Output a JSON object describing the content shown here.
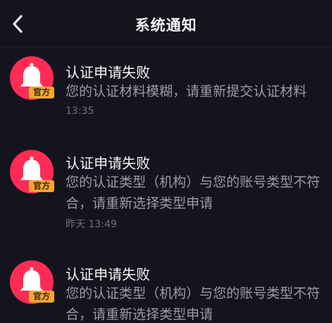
{
  "header": {
    "title": "系统通知",
    "back_icon": "chevron-left-icon"
  },
  "colors": {
    "background": "#14141f",
    "avatar_bg": "#fe2c55",
    "badge_bg": "#f4a536",
    "text_primary": "#f5f5f5",
    "text_secondary": "#9b9ba6",
    "text_time": "#6f6f7a"
  },
  "messages": [
    {
      "icon": "bell-icon",
      "badge": "官方",
      "title": "认证申请失败",
      "body": "您的认证材料模糊，请重新提交认证材料",
      "time": "13:35"
    },
    {
      "icon": "bell-icon",
      "badge": "官方",
      "title": "认证申请失败",
      "body": "您的认证类型（机构）与您的账号类型不符合，请重新选择类型申请",
      "time": "昨天 13:49"
    },
    {
      "icon": "bell-icon",
      "badge": "官方",
      "title": "认证申请失败",
      "body": "您的认证类型（机构）与您的账号类型不符合，请重新选择类型申请",
      "time": ""
    }
  ]
}
